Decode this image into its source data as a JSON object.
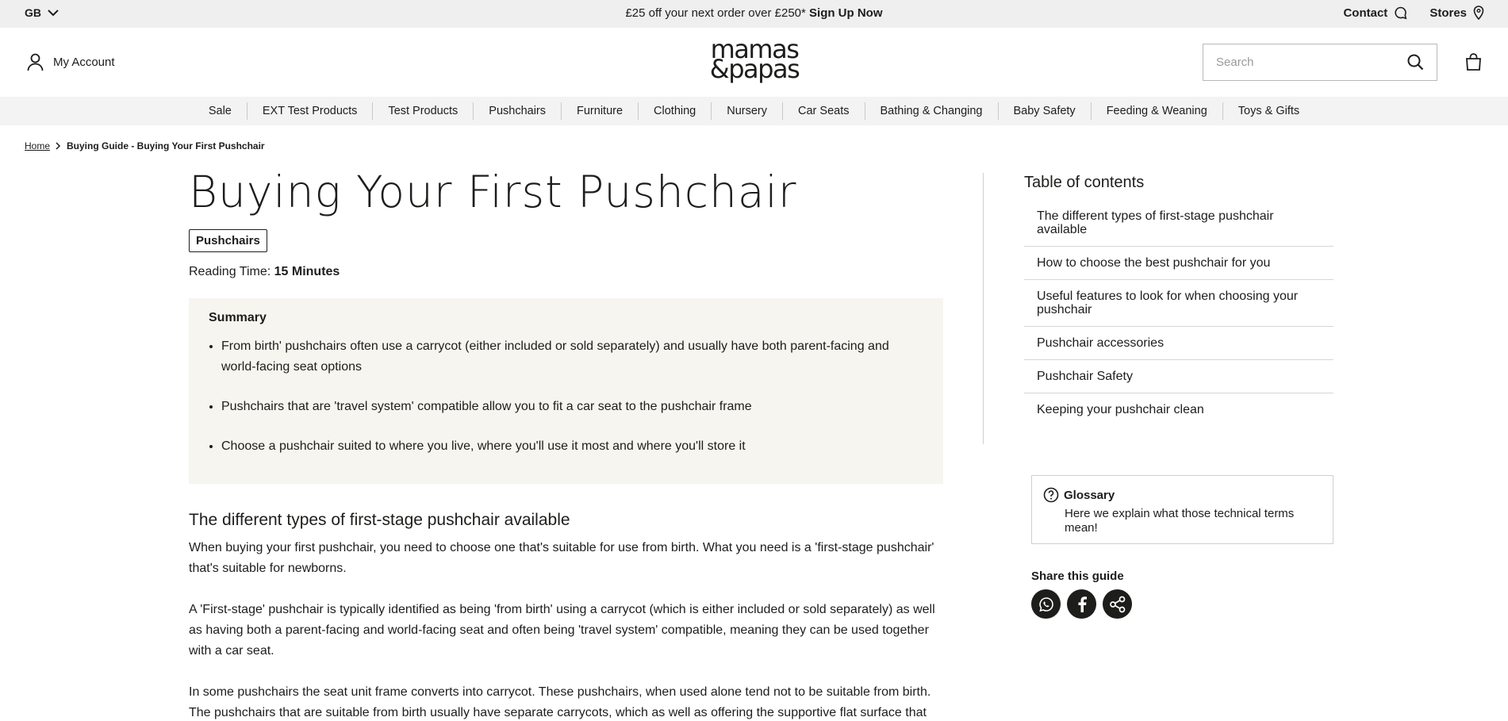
{
  "promo": {
    "region": "GB",
    "message": "£25 off your next order over £250*",
    "cta": "Sign Up Now",
    "contact": "Contact",
    "stores": "Stores"
  },
  "header": {
    "account": "My Account",
    "logo_line1": "mamas",
    "logo_line2": "&papas",
    "search_placeholder": "Search"
  },
  "nav": {
    "items": [
      "Sale",
      "EXT Test Products",
      "Test Products",
      "Pushchairs",
      "Furniture",
      "Clothing",
      "Nursery",
      "Car Seats",
      "Bathing & Changing",
      "Baby Safety",
      "Feeding & Weaning",
      "Toys & Gifts"
    ]
  },
  "breadcrumb": {
    "home": "Home",
    "current": "Buying Guide - Buying Your First Pushchair"
  },
  "article": {
    "title": "Buying Your First Pushchair",
    "tag": "Pushchairs",
    "reading_label": "Reading Time:",
    "reading_value": "15 Minutes",
    "summary_title": "Summary",
    "summary_items": [
      "From birth' pushchairs often use a carrycot (either included or sold separately) and usually have both parent-facing and world-facing seat options",
      "Pushchairs that are 'travel system' compatible allow you to fit a car seat to the pushchair frame",
      "Choose a pushchair suited to where you live, where you'll use it most and where you'll store it"
    ],
    "section_heading": "The different types of first-stage pushchair available",
    "paragraphs": [
      "When buying your first pushchair, you need to choose one that's suitable for use from birth. What you need is a 'first-stage pushchair' that's suitable for newborns.",
      "A 'First-stage' pushchair is typically identified as being 'from birth' using a carrycot (which is either included or sold separately) as well as having both a parent-facing and world-facing seat and often being 'travel system' compatible, meaning they can be used together with a car seat.",
      "In some pushchairs the seat unit frame converts into carrycot. These pushchairs, when used alone tend not to be suitable from birth. The pushchairs that are suitable from birth usually have separate carrycots, which as well as offering the supportive flat surface that"
    ]
  },
  "toc": {
    "title": "Table of contents",
    "items": [
      "The different types of first-stage pushchair available",
      "How to choose the best pushchair for you",
      "Useful features to look for when choosing your pushchair",
      "Pushchair accessories",
      "Pushchair Safety",
      "Keeping your pushchair clean"
    ]
  },
  "glossary": {
    "title": "Glossary",
    "text": "Here we explain what those technical terms mean!"
  },
  "share": {
    "label": "Share this guide"
  }
}
